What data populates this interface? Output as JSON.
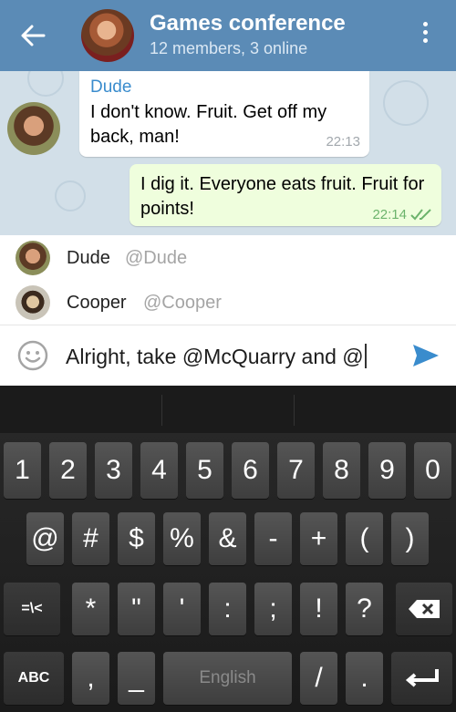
{
  "header": {
    "title": "Games conference",
    "subtitle": "12 members, 3 online"
  },
  "messages": [
    {
      "sender": "Dude",
      "text": "I don't know. Fruit. Get off my back, man!",
      "time": "22:13",
      "direction": "incoming"
    },
    {
      "text": "I dig it. Everyone eats fruit. Fruit for points!",
      "time": "22:14",
      "direction": "outgoing",
      "status": "read"
    }
  ],
  "mentions": [
    {
      "name": "Dude",
      "handle": "@Dude"
    },
    {
      "name": "Cooper",
      "handle": "@Cooper"
    }
  ],
  "composer": {
    "text": "Alright, take @McQuarry and @"
  },
  "keyboard": {
    "row1": [
      "1",
      "2",
      "3",
      "4",
      "5",
      "6",
      "7",
      "8",
      "9",
      "0"
    ],
    "row2": [
      "@",
      "#",
      "$",
      "%",
      "&",
      "-",
      "+",
      "(",
      ")"
    ],
    "row3": [
      "=\\<",
      "*",
      "\"",
      "'",
      ":",
      ";",
      "!",
      "?"
    ],
    "row4": [
      "ABC",
      ",",
      "_",
      "English",
      "/",
      "."
    ]
  },
  "colors": {
    "header": "#5b8bb6",
    "incoming_name": "#3a8ccd",
    "outgoing_bubble": "#effedd",
    "send": "#3a8ccd"
  }
}
